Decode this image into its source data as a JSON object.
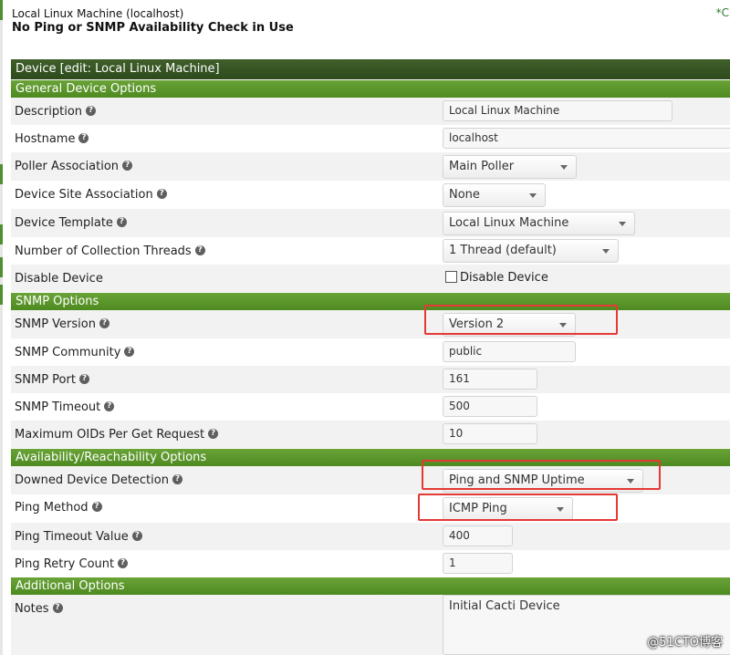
{
  "header": {
    "device_title": "Local Linux Machine (localhost)",
    "status": "No Ping or SNMP Availability Check in Use",
    "right_note": "*C"
  },
  "device_bar": {
    "title": "Device [edit: Local Linux Machine]"
  },
  "sections": {
    "general": "General Device Options",
    "snmp": "SNMP Options",
    "availability": "Availability/Reachability Options",
    "additional": "Additional Options"
  },
  "help_glyph": "?",
  "fields": {
    "description": {
      "label": "Description",
      "value": "Local Linux Machine"
    },
    "hostname": {
      "label": "Hostname",
      "value": "localhost"
    },
    "poller": {
      "label": "Poller Association",
      "value": "Main Poller"
    },
    "site": {
      "label": "Device Site Association",
      "value": "None"
    },
    "template": {
      "label": "Device Template",
      "value": "Local Linux Machine"
    },
    "threads": {
      "label": "Number of Collection Threads",
      "value": "1 Thread (default)"
    },
    "disable": {
      "label": "Disable Device",
      "checkbox_label": "Disable Device",
      "checked": false
    },
    "snmp_version": {
      "label": "SNMP Version",
      "value": "Version 2"
    },
    "snmp_community": {
      "label": "SNMP Community",
      "value": "public"
    },
    "snmp_port": {
      "label": "SNMP Port",
      "value": "161"
    },
    "snmp_timeout": {
      "label": "SNMP Timeout",
      "value": "500"
    },
    "max_oids": {
      "label": "Maximum OIDs Per Get Request",
      "value": "10"
    },
    "downed_detection": {
      "label": "Downed Device Detection",
      "value": "Ping and SNMP Uptime"
    },
    "ping_method": {
      "label": "Ping Method",
      "value": "ICMP Ping"
    },
    "ping_timeout": {
      "label": "Ping Timeout Value",
      "value": "400"
    },
    "ping_retry": {
      "label": "Ping Retry Count",
      "value": "1"
    },
    "notes": {
      "label": "Notes",
      "value": "Initial Cacti Device"
    }
  },
  "watermark": "@51CTO博客",
  "colors": {
    "section_green": "#5a9a2a",
    "device_bar_dark": "#365422",
    "highlight_red": "#e53935",
    "row_alt": "#f2f2f2"
  }
}
